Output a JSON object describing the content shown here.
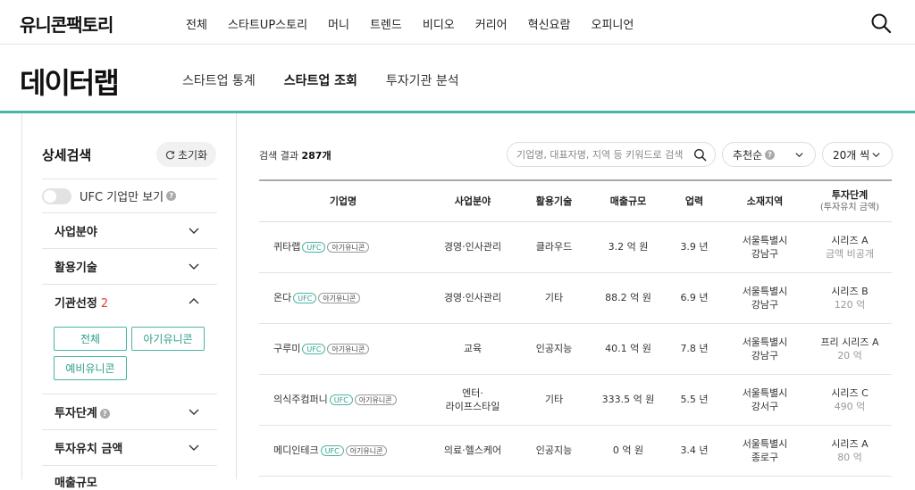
{
  "header": {
    "logo": "유니콘팩토리",
    "nav": [
      "전체",
      "스타트UP스토리",
      "머니",
      "트렌드",
      "비디오",
      "커리어",
      "혁신요람",
      "오피니언"
    ]
  },
  "page": {
    "title": "데이터랩",
    "subnav": [
      {
        "label": "스타트업 통계",
        "active": false
      },
      {
        "label": "스타트업 조회",
        "active": true
      },
      {
        "label": "투자기관 분석",
        "active": false
      }
    ]
  },
  "sidebar": {
    "title": "상세검색",
    "reset_label": "초기화",
    "ufc_toggle_label": "UFC 기업만 보기",
    "filters": {
      "field": "사업분야",
      "tech": "활용기술",
      "selection": "기관선정",
      "selection_count": "2",
      "stage": "투자단계",
      "amount": "투자유치 금액",
      "cut": "매출규모"
    },
    "chips": [
      "전체",
      "아기유니콘",
      "예비유니콘"
    ]
  },
  "results": {
    "count_prefix": "검색 결과 ",
    "count": "287개",
    "search_placeholder": "기업명, 대표자명, 지역 등 키워드로 검색",
    "sort_label": "추천순",
    "per_page_label": "20개 씩",
    "columns": {
      "name": "기업명",
      "field": "사업분야",
      "tech": "활용기술",
      "revenue": "매출규모",
      "years": "업력",
      "region": "소재지역",
      "stage": "투자단계",
      "stage_sub": "(투자유치 금액)"
    },
    "tags": {
      "ufc": "UFC",
      "baby": "아기유니콘"
    },
    "rows": [
      {
        "name": "퀴타랩",
        "field1": "경영·인사관리",
        "field2": "",
        "tech": "클라우드",
        "revenue": "3.2 억 원",
        "years": "3.9 년",
        "region1": "서울특별시",
        "region2": "강남구",
        "stage": "시리즈 A",
        "amount": "금액 비공개"
      },
      {
        "name": "온다",
        "field1": "경영·인사관리",
        "field2": "",
        "tech": "기타",
        "revenue": "88.2 억 원",
        "years": "6.9 년",
        "region1": "서울특별시",
        "region2": "강남구",
        "stage": "시리즈 B",
        "amount": "120 억"
      },
      {
        "name": "구루미",
        "field1": "교육",
        "field2": "",
        "tech": "인공지능",
        "revenue": "40.1 억 원",
        "years": "7.8 년",
        "region1": "서울특별시",
        "region2": "강남구",
        "stage": "프리 시리즈 A",
        "amount": "20 억"
      },
      {
        "name": "의식주컴퍼니",
        "field1": "엔터·",
        "field2": "라이프스타일",
        "tech": "기타",
        "revenue": "333.5 억 원",
        "years": "5.5 년",
        "region1": "서울특별시",
        "region2": "강서구",
        "stage": "시리즈 C",
        "amount": "490 억"
      },
      {
        "name": "메디인테크",
        "field1": "의료·헬스케어",
        "field2": "",
        "tech": "인공지능",
        "revenue": "0 억 원",
        "years": "3.4 년",
        "region1": "서울특별시",
        "region2": "종로구",
        "stage": "시리즈 A",
        "amount": "80 억"
      }
    ]
  },
  "colors": {
    "accent": "#49b5a5",
    "alert": "#e03c3c"
  }
}
